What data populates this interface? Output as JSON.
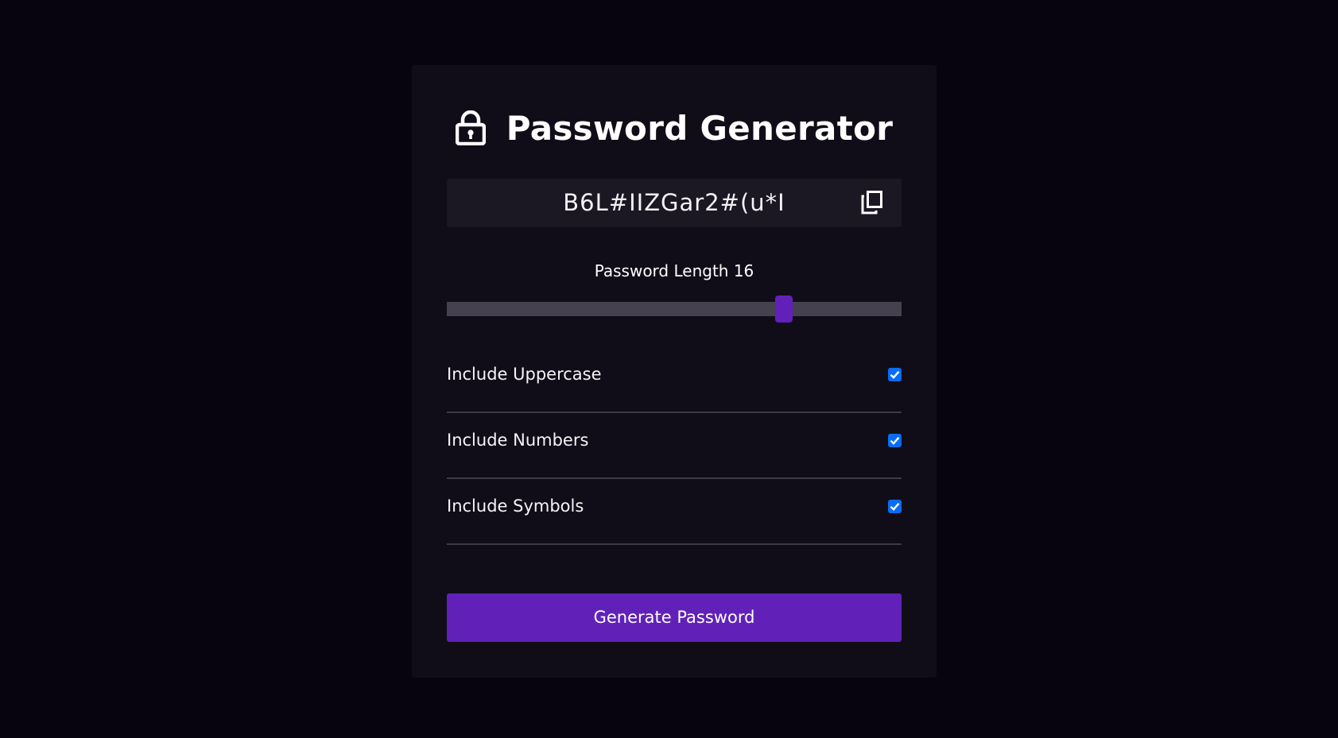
{
  "app": {
    "title": "Password Generator",
    "accent_color": "#6121b9",
    "background_color": "#07030f",
    "card_color": "#110d18"
  },
  "password": {
    "value": "B6L#IIZGar2#(u*I",
    "copy_icon": "copy-icon"
  },
  "length": {
    "label": "Password Length 16",
    "value": 16,
    "min": 4,
    "max": 20
  },
  "options": [
    {
      "label": "Include Uppercase",
      "checked": true
    },
    {
      "label": "Include Numbers",
      "checked": true
    },
    {
      "label": "Include Symbols",
      "checked": true
    }
  ],
  "actions": {
    "generate_label": "Generate Password"
  },
  "icons": {
    "title": "lock-icon",
    "checkbox_mark": "checkmark-icon"
  }
}
